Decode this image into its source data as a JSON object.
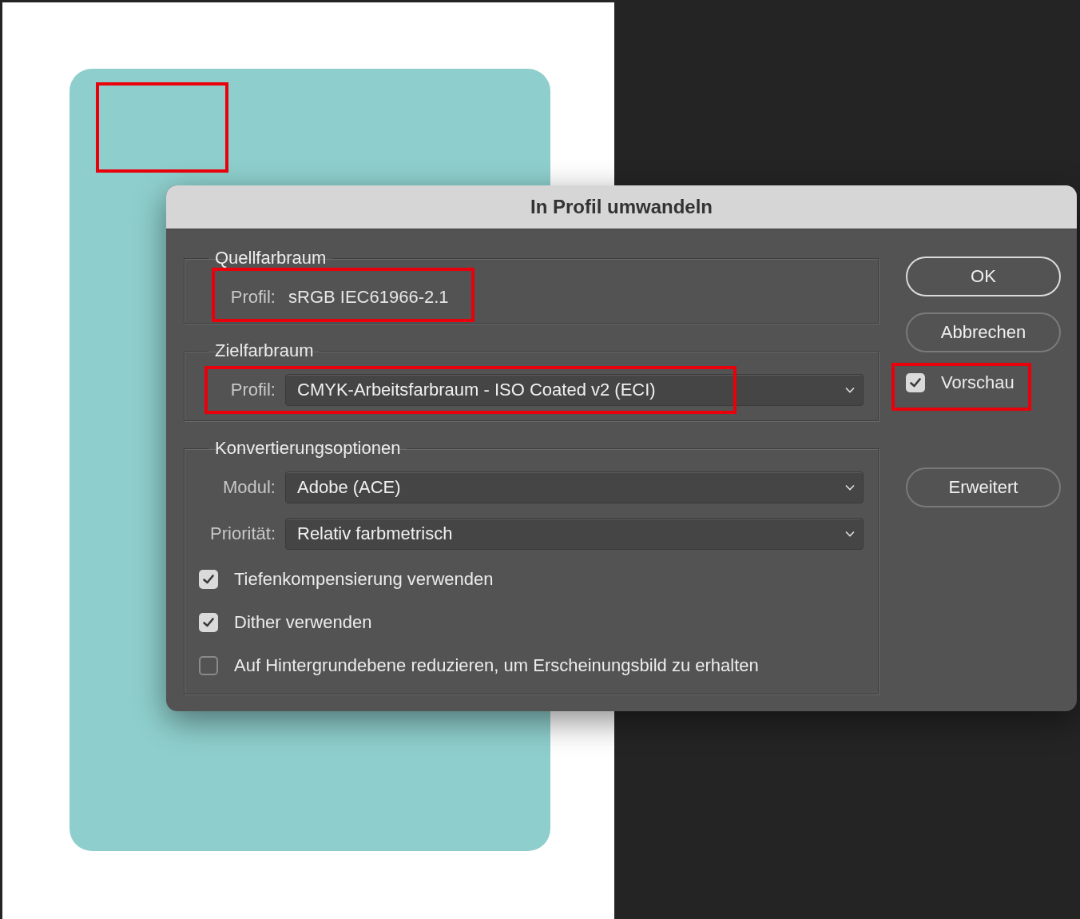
{
  "dialog": {
    "title": "In Profil umwandeln",
    "source": {
      "legend": "Quellfarbraum",
      "label": "Profil:",
      "value": "sRGB IEC61966-2.1"
    },
    "destination": {
      "legend": "Zielfarbraum",
      "selects": [
        {
          "label": "Profil:",
          "value": "CMYK-Arbeitsfarbraum - ISO Coated v2 (ECI)"
        }
      ]
    },
    "conversion": {
      "legend": "Konvertierungsoptionen",
      "selects": [
        {
          "label": "Modul:",
          "value": "Adobe (ACE)"
        },
        {
          "label": "Priorität:",
          "value": "Relativ farbmetrisch"
        }
      ],
      "options": [
        {
          "label": "Tiefenkompensierung verwenden",
          "checked": true
        },
        {
          "label": "Dither verwenden",
          "checked": true
        },
        {
          "label": "Auf Hintergrundebene reduzieren, um Erscheinungsbild zu erhalten",
          "checked": false
        }
      ]
    },
    "buttons": [
      {
        "label": "OK",
        "kind": "default"
      },
      {
        "label": "Abbrechen",
        "kind": "normal"
      }
    ],
    "preview": {
      "label": "Vorschau",
      "checked": true
    },
    "advanced": {
      "label": "Erweitert"
    }
  }
}
